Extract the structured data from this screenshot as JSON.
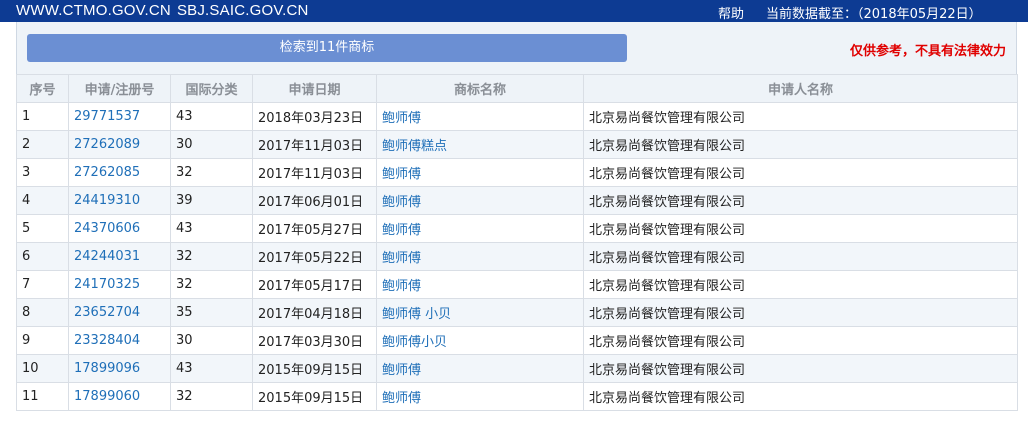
{
  "header": {
    "site1": "WWW.CTMO.GOV.CN",
    "site2": "SBJ.SAIC.GOV.CN",
    "help": "帮助",
    "data_date": "当前数据截至：（2018年05月22日）"
  },
  "panel": {
    "result_label": "检索到11件商标",
    "disclaimer": "仅供参考，不具有法律效力"
  },
  "table": {
    "columns": [
      "序号",
      "申请/注册号",
      "国际分类",
      "申请日期",
      "商标名称",
      "申请人名称"
    ],
    "rows": [
      {
        "no": "1",
        "reg": "29771537",
        "cls": "43",
        "date": "2018年03月23日",
        "name": "鲍师傅",
        "applicant": "北京易尚餐饮管理有限公司"
      },
      {
        "no": "2",
        "reg": "27262089",
        "cls": "30",
        "date": "2017年11月03日",
        "name": "鲍师傅糕点",
        "applicant": "北京易尚餐饮管理有限公司"
      },
      {
        "no": "3",
        "reg": "27262085",
        "cls": "32",
        "date": "2017年11月03日",
        "name": "鲍师傅",
        "applicant": "北京易尚餐饮管理有限公司"
      },
      {
        "no": "4",
        "reg": "24419310",
        "cls": "39",
        "date": "2017年06月01日",
        "name": "鲍师傅",
        "applicant": "北京易尚餐饮管理有限公司"
      },
      {
        "no": "5",
        "reg": "24370606",
        "cls": "43",
        "date": "2017年05月27日",
        "name": "鲍师傅",
        "applicant": "北京易尚餐饮管理有限公司"
      },
      {
        "no": "6",
        "reg": "24244031",
        "cls": "32",
        "date": "2017年05月22日",
        "name": "鲍师傅",
        "applicant": "北京易尚餐饮管理有限公司"
      },
      {
        "no": "7",
        "reg": "24170325",
        "cls": "32",
        "date": "2017年05月17日",
        "name": "鲍师傅",
        "applicant": "北京易尚餐饮管理有限公司"
      },
      {
        "no": "8",
        "reg": "23652704",
        "cls": "35",
        "date": "2017年04月18日",
        "name": "鲍师傅 小贝",
        "applicant": "北京易尚餐饮管理有限公司"
      },
      {
        "no": "9",
        "reg": "23328404",
        "cls": "30",
        "date": "2017年03月30日",
        "name": "鲍师傅小贝",
        "applicant": "北京易尚餐饮管理有限公司"
      },
      {
        "no": "10",
        "reg": "17899096",
        "cls": "43",
        "date": "2015年09月15日",
        "name": "鲍师傅",
        "applicant": "北京易尚餐饮管理有限公司"
      },
      {
        "no": "11",
        "reg": "17899060",
        "cls": "32",
        "date": "2015年09月15日",
        "name": "鲍师傅",
        "applicant": "北京易尚餐饮管理有限公司"
      }
    ]
  }
}
